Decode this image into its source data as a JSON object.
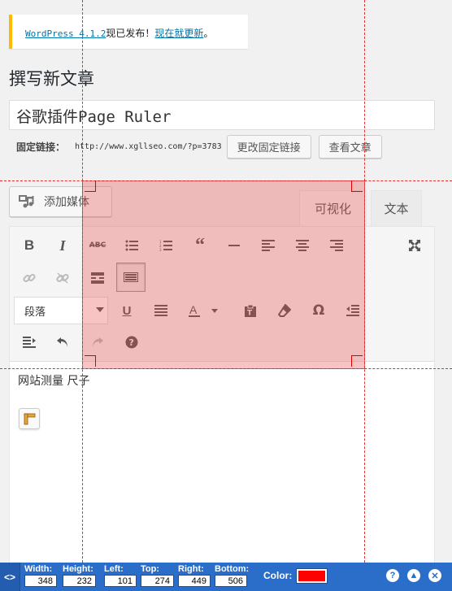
{
  "notice": {
    "link_version": "WordPress 4.1.2",
    "text": "现已发布！",
    "link_update": "现在就更新",
    "end": "。"
  },
  "page": {
    "heading": "撰写新文章",
    "post_title": "谷歌插件Page Ruler"
  },
  "permalink": {
    "label": "固定链接：",
    "url": "http://www.xgllseo.com/?p=3783",
    "edit_button": "更改固定链接",
    "view_button": "查看文章"
  },
  "editor": {
    "add_media": "添加媒体",
    "tabs": [
      {
        "label": "可视化"
      },
      {
        "label": "文本"
      }
    ],
    "format_select": "段落",
    "content_text": "网站测量 尺子"
  },
  "toolbar_icons": [
    "bold-icon",
    "italic-icon",
    "strikethrough-icon",
    "bullet-list-icon",
    "numbered-list-icon",
    "blockquote-icon",
    "horizontal-rule-icon",
    "align-left-icon",
    "align-center-icon",
    "align-right-icon",
    "fullscreen-icon",
    "insert-link-icon",
    "remove-link-icon",
    "read-more-icon",
    "toolbar-toggle-icon",
    "underline-icon",
    "justify-icon",
    "text-color-icon",
    "paste-as-text-icon",
    "clear-formatting-icon",
    "special-character-icon",
    "outdent-icon",
    "indent-icon",
    "undo-icon",
    "redo-icon",
    "help-icon"
  ],
  "ruler": {
    "width_label": "Width:",
    "width": "348",
    "height_label": "Height:",
    "height": "232",
    "left_label": "Left:",
    "left": "101",
    "top_label": "Top:",
    "top": "274",
    "right_label": "Right:",
    "right": "449",
    "bottom_label": "Bottom:",
    "bottom": "506",
    "color_label": "Color:",
    "color": "#ff0000",
    "overlay_color": "#e84848"
  },
  "colors": {
    "accent": "#2b6ec9",
    "notice_border": "#ffba00",
    "link": "#0073aa"
  }
}
